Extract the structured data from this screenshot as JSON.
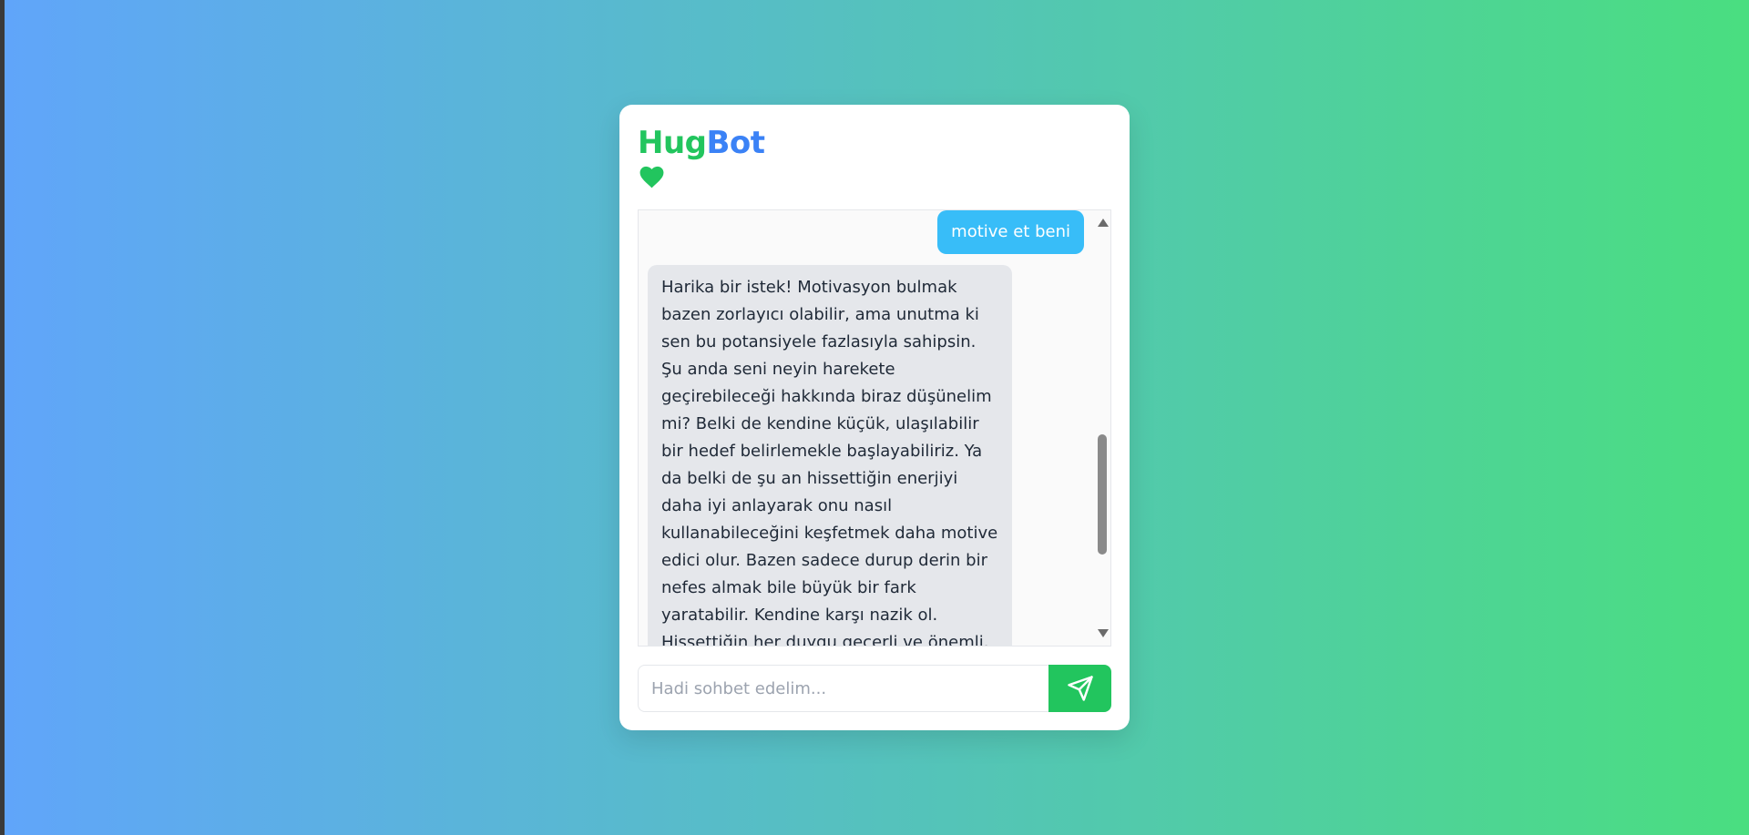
{
  "colors": {
    "green": "#22c55e",
    "blue": "#3b82f6",
    "user_bubble": "#38bdf8",
    "gradient_start": "#60a5fa",
    "gradient_end": "#4ade80"
  },
  "header": {
    "brand_part1": "Hug",
    "brand_part2": "Bot",
    "icon": "heart-icon"
  },
  "chat": {
    "messages": [
      {
        "role": "user",
        "text": "motive et beni"
      },
      {
        "role": "bot",
        "text": "Harika bir istek! Motivasyon bulmak bazen zorlayıcı olabilir, ama unutma ki sen bu potansiyele fazlasıyla sahipsin. Şu anda seni neyin harekete geçirebileceği hakkında biraz düşünelim mi? Belki de kendine küçük, ulaşılabilir bir hedef belirlemekle başlayabiliriz. Ya da belki de şu an hissettiğin enerjiyi daha iyi anlayarak onu nasıl kullanabileceğini keşfetmek daha motive edici olur. Bazen sadece durup derin bir nefes almak bile büyük bir fark yaratabilir. Kendine karşı nazik ol. Hissettiğin her duygu geçerli ve önemli. Kendini kötü hissettiğinde bile, bu"
      }
    ]
  },
  "composer": {
    "placeholder": "Hadi sohbet edelim...",
    "value": "",
    "send_icon": "send-icon"
  }
}
